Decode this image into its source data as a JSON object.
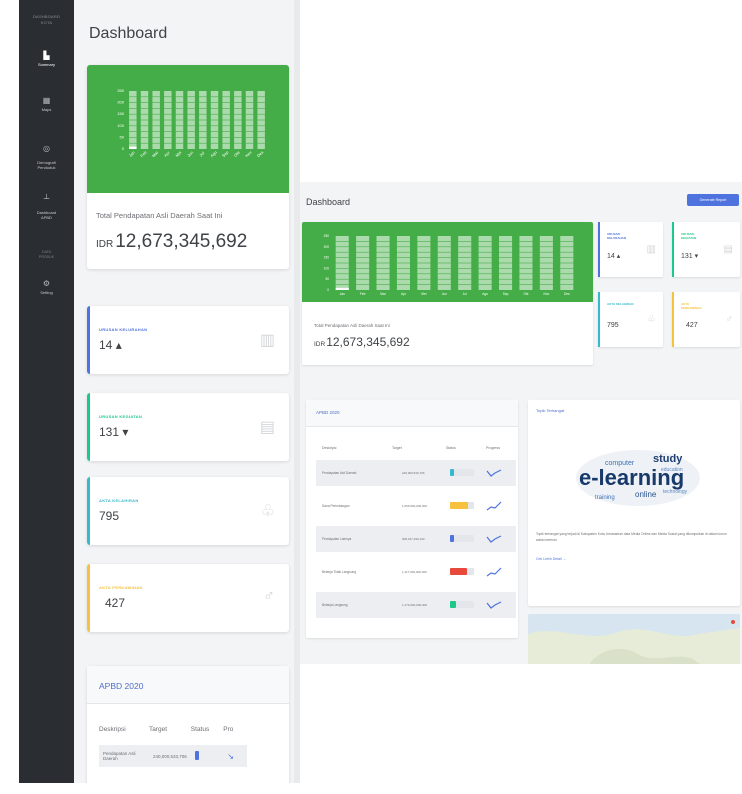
{
  "sidebar": {
    "brand": "DASHBOARD\nKOTA",
    "nav": [
      {
        "label": "Summary",
        "icon": "bar-chart-icon",
        "active": true
      },
      {
        "label": "Maps",
        "icon": "table-icon",
        "active": false
      },
      {
        "label": "Demografi\nPenduduk",
        "icon": "globe-icon",
        "active": false
      },
      {
        "label": "Dashboard\nAPBD",
        "icon": "sitemap-icon",
        "active": false
      },
      {
        "label": "Setting",
        "icon": "gear-icon",
        "active": false
      }
    ],
    "section_heading": "DATA\nPRODUK"
  },
  "page": {
    "title": "Dashboard",
    "report_button": "Generate Report"
  },
  "income": {
    "label": "Total Pendapatan Asli Daerah Saat Ini",
    "currency": "IDR",
    "value": "12,673,345,692"
  },
  "stats": [
    {
      "label": "URUSAN KELURAHAN",
      "value": "14",
      "trend": "▴",
      "color": "#4e73df",
      "icon": "building-icon"
    },
    {
      "label": "URUSAN KEGIATAN",
      "value": "131",
      "trend": "▾",
      "color": "#1cc88a",
      "icon": "calendar-icon"
    },
    {
      "label": "AKTA KELAHIRAN",
      "value": "795",
      "trend": "",
      "color": "#36b9cc",
      "icon": "baby-icon"
    },
    {
      "label": "AKTA PERKAWINAN",
      "value": "427",
      "trend": "",
      "color": "#f6c23e",
      "icon": "ring-icon"
    }
  ],
  "apbd": {
    "title": "APBD 2020",
    "columns": [
      "Deskripsi",
      "Target",
      "Status",
      "Progress"
    ],
    "rows": [
      {
        "desc": "Pendapatan Asli Daerah",
        "target": "240,000,533,706",
        "status_color": "#36b9cc",
        "status_pct": 18
      },
      {
        "desc": "Dana Perimbangan",
        "target": "1,056,500,000,000",
        "status_color": "#f6c23e",
        "status_pct": 75
      },
      {
        "desc": "Pendapatan Lainnya",
        "target": "308,017,490,133",
        "status_color": "#4e73df",
        "status_pct": 15
      },
      {
        "desc": "Belanja Tidak Langsung",
        "target": "1,117,000,000,000",
        "status_color": "#e74a3b",
        "status_pct": 70
      },
      {
        "desc": "Belanja Langsung",
        "target": "1,170,000,000,000",
        "status_color": "#1cc88a",
        "status_pct": 25
      }
    ],
    "mobile_rows": [
      {
        "desc": "Pendapatan Asli Daerah",
        "target": "240,000,533,706"
      }
    ]
  },
  "topic": {
    "title": "Topik Terhangat",
    "words": [
      "e-learning",
      "study",
      "computer",
      "training",
      "online",
      "education",
      "technology"
    ],
    "description": "Topik terhangat yang terjadi di Kabupaten Kota, berasarkan data Media Online dan Media Sosial yang dikumpulkan di dalam kurun waktu tertentu",
    "link": "Cek Lebih Detail →"
  },
  "colors": {
    "sidebar_bg": "#2a2d31",
    "chart_green": "#45ad47",
    "accent_blue": "#4e73df"
  },
  "chart_data": [
    {
      "type": "bar",
      "categories": [
        "Jan",
        "Feb",
        "Mar",
        "Apr",
        "Mei",
        "Jun",
        "Jul",
        "Agu",
        "Sep",
        "Okt",
        "Nov",
        "Des"
      ],
      "series": [
        {
          "values": [
            10,
            0,
            0,
            0,
            0,
            0,
            0,
            0,
            0,
            0,
            0,
            0
          ]
        }
      ],
      "ylim": [
        0,
        250
      ],
      "yticks": [
        "250",
        "200",
        "150",
        "100",
        "50",
        "0"
      ],
      "title": "",
      "xlabel": "",
      "ylabel": ""
    },
    {
      "type": "bar",
      "categories": [
        "Jan",
        "Feb",
        "Mar",
        "Apr",
        "Mei",
        "Jun",
        "Jul",
        "Agu",
        "Sep",
        "Okt",
        "Nov",
        "Des"
      ],
      "series": [
        {
          "values": [
            10,
            0,
            0,
            0,
            0,
            0,
            0,
            0,
            0,
            0,
            0,
            0
          ]
        }
      ],
      "ylim": [
        0,
        250
      ],
      "yticks": [
        "250",
        "200",
        "150",
        "100",
        "50",
        "0"
      ],
      "title": "",
      "xlabel": "",
      "ylabel": ""
    }
  ]
}
